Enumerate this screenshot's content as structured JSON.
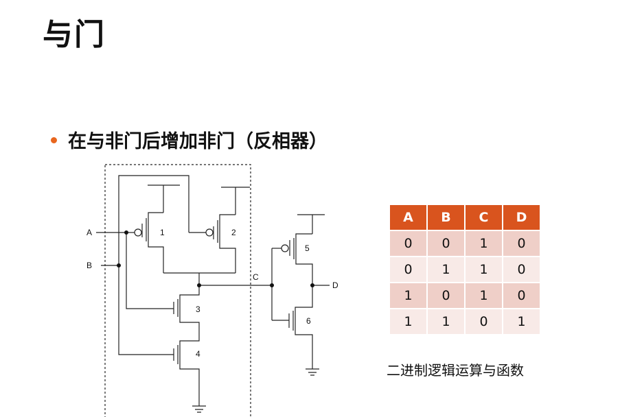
{
  "slide": {
    "title": "与门",
    "bullet": "在与非门后增加非门（反相器）",
    "caption": "二进制逻辑运算与函数"
  },
  "circuit": {
    "labels": {
      "A": "A",
      "B": "B",
      "C": "C",
      "D": "D",
      "t1": "1",
      "t2": "2",
      "t3": "3",
      "t4": "4",
      "t5": "5",
      "t6": "6"
    }
  },
  "truth_table": {
    "headers": [
      "A",
      "B",
      "C",
      "D"
    ],
    "rows": [
      [
        "0",
        "0",
        "1",
        "0"
      ],
      [
        "0",
        "1",
        "1",
        "0"
      ],
      [
        "1",
        "0",
        "1",
        "0"
      ],
      [
        "1",
        "1",
        "0",
        "1"
      ]
    ]
  },
  "colors": {
    "accent": "#e8661e",
    "table_header": "#d9541e",
    "row_odd": "#efcfc8",
    "row_even": "#f8eae7"
  }
}
